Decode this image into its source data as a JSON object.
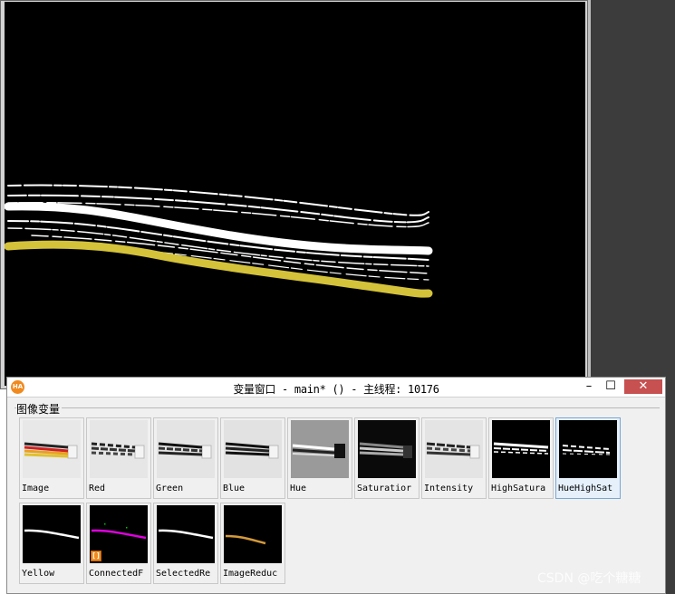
{
  "variable_window": {
    "title": "变量窗口 - main* () - 主线程: 10176",
    "logo_text": "HA",
    "controls": {
      "minimize": "–",
      "maximize": "☐",
      "close": "✕"
    },
    "group_label": "图像变量",
    "thumbnails": [
      {
        "label": "Image"
      },
      {
        "label": "Red"
      },
      {
        "label": "Green"
      },
      {
        "label": "Blue"
      },
      {
        "label": "Hue"
      },
      {
        "label": "Saturatior"
      },
      {
        "label": "Intensity"
      },
      {
        "label": "HighSatura"
      },
      {
        "label": "HueHighSat",
        "selected": true
      },
      {
        "label": "Yellow"
      },
      {
        "label": "ConnectedF",
        "badge": "[]"
      },
      {
        "label": "SelectedRe"
      },
      {
        "label": "ImageReduc"
      }
    ]
  },
  "watermark": "CSDN @吃个糖糖",
  "colors": {
    "canvas_background": "#000000",
    "highlight_region": "#d4c23a",
    "connected_region": "#e000e0",
    "reduced_region": "#d49a3a",
    "selected_border": "#7aa6d4"
  }
}
